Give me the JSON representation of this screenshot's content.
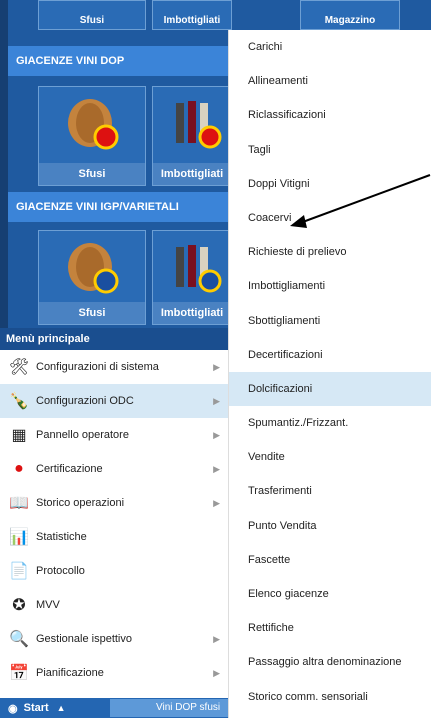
{
  "top_tabs": [
    "Sfusi",
    "Imbottigliati",
    "Magazzino"
  ],
  "sections": [
    {
      "title": "GIACENZE VINI DOP",
      "tiles": [
        "Sfusi",
        "Imbottigliati"
      ]
    },
    {
      "title": "GIACENZE VINI IGP/VARIETALI",
      "tiles": [
        "Sfusi",
        "Imbottigliati"
      ]
    }
  ],
  "main_menu": {
    "header": "Menù principale",
    "items": [
      {
        "label": "Configurazioni di sistema",
        "icon": "tools-icon",
        "submenu": true
      },
      {
        "label": "Configurazioni ODC",
        "icon": "bottle-icon",
        "submenu": true,
        "active": true
      },
      {
        "label": "Pannello operatore",
        "icon": "panel-icon",
        "submenu": true
      },
      {
        "label": "Certificazione",
        "icon": "ribbon-icon",
        "submenu": true
      },
      {
        "label": "Storico operazioni",
        "icon": "book-icon",
        "submenu": true
      },
      {
        "label": "Statistiche",
        "icon": "chart-icon",
        "submenu": false
      },
      {
        "label": "Protocollo",
        "icon": "document-icon",
        "submenu": false
      },
      {
        "label": "MVV",
        "icon": "emblem-icon",
        "submenu": false
      },
      {
        "label": "Gestionale ispettivo",
        "icon": "inspector-icon",
        "submenu": true
      },
      {
        "label": "Pianificazione",
        "icon": "calendar-icon",
        "submenu": true
      }
    ]
  },
  "submenu": {
    "items": [
      "Carichi",
      "Allineamenti",
      "Riclassificazioni",
      "Tagli",
      "Doppi Vitigni",
      "Coacervi",
      "Richieste di prelievo",
      "Imbottigliamenti",
      "Sbottigliamenti",
      "Decertificazioni",
      "Dolcificazioni",
      "Spumantiz./Frizzant.",
      "Vendite",
      "Trasferimenti",
      "Punto Vendita",
      "Fascette",
      "Elenco giacenze",
      "Rettifiche",
      "Passaggio altra denominazione",
      "Storico comm. sensoriali"
    ],
    "hover_index": 10
  },
  "taskbar": {
    "start_label": "Start",
    "item_label": "Vini DOP sfusi"
  },
  "colors": {
    "brand_blue": "#1f5aa0",
    "hover_bg": "#d6e8f5",
    "section_header": "#3b84d8"
  }
}
